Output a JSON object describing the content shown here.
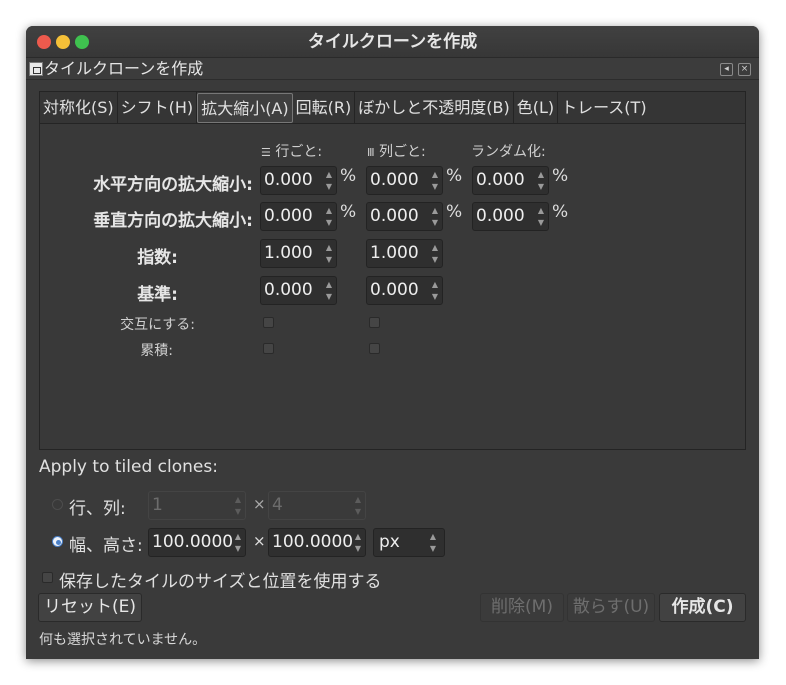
{
  "window": {
    "title": "タイルクローンを作成"
  },
  "dock": {
    "title": "タイルクローンを作成"
  },
  "tabs": [
    {
      "label": "対称化(S)"
    },
    {
      "label": "シフト(H)"
    },
    {
      "label": "拡大縮小(A)"
    },
    {
      "label": "回転(R)"
    },
    {
      "label": "ぼかしと不透明度(B)"
    },
    {
      "label": "色(L)"
    },
    {
      "label": "トレース(T)"
    }
  ],
  "scale_panel": {
    "col_headers": {
      "per_row": "行ごと:",
      "per_column": "列ごと:",
      "random": "ランダム化:"
    },
    "percent": "%",
    "rows": [
      {
        "label": "水平方向の拡大縮小:",
        "per_row": "0.000",
        "per_column": "0.000",
        "random": "0.000"
      },
      {
        "label": "垂直方向の拡大縮小:",
        "per_row": "0.000",
        "per_column": "0.000",
        "random": "0.000"
      },
      {
        "label": "指数:",
        "per_row": "1.000",
        "per_column": "1.000"
      },
      {
        "label": "基準:",
        "per_row": "0.000",
        "per_column": "0.000"
      }
    ],
    "alternate_label": "交互にする:",
    "cumulative_label": "累積:"
  },
  "apply": {
    "heading": "Apply to tiled clones:",
    "rows_cols_label": "行、列:",
    "rows_value": "1",
    "cols_value": "4",
    "times": "×",
    "width_height_label": "幅、高さ:",
    "width_value": "100.0000",
    "height_value": "100.0000",
    "unit": "px",
    "use_saved_label": "保存したタイルのサイズと位置を使用する"
  },
  "buttons": {
    "reset": "リセット(E)",
    "delete": "削除(M)",
    "unclump": "散らす(U)",
    "create": "作成(C)"
  },
  "status": "何も選択されていません。",
  "colors": {
    "close": "#ed5a4d",
    "minimize": "#f5c038",
    "maximize": "#3fc14f",
    "accent": "#4a80c8"
  }
}
